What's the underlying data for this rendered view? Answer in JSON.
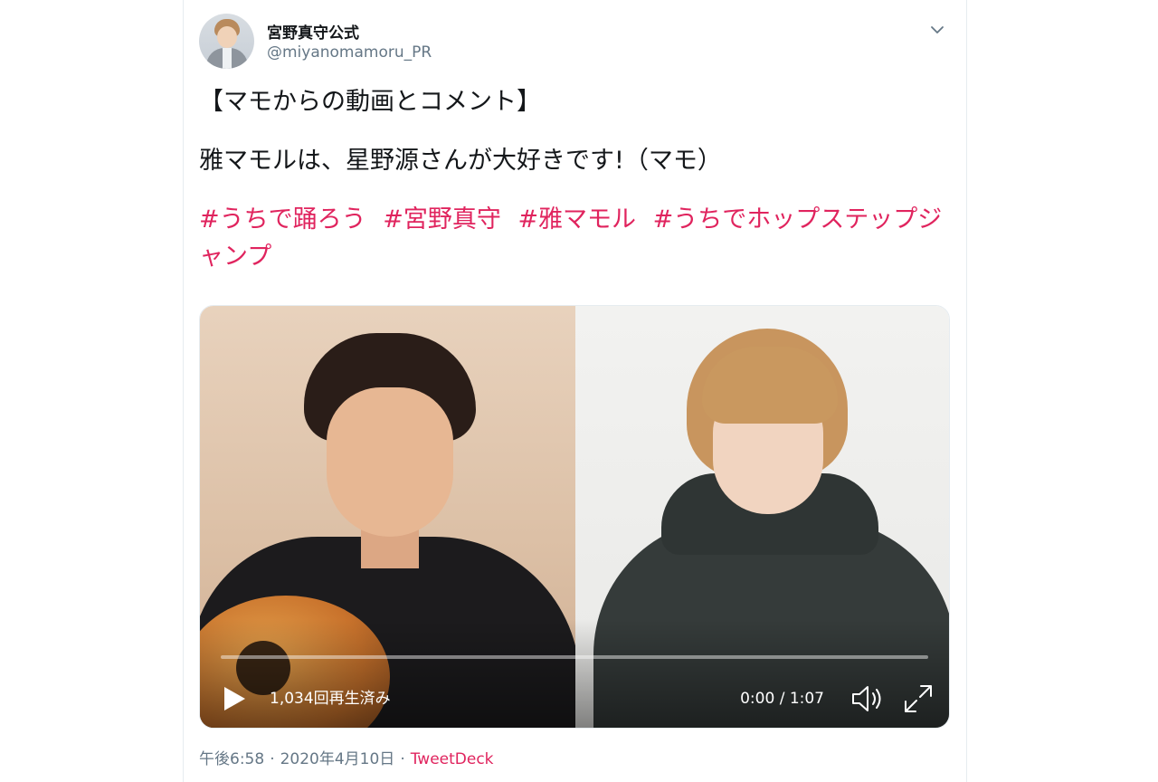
{
  "user": {
    "display_name": "宮野真守公式",
    "handle": "@miyanomamoru_PR"
  },
  "icons": {
    "avatar": "avatar",
    "menu": "chevron-down-icon",
    "play": "play-icon",
    "volume": "volume-icon",
    "fullscreen": "fullscreen-icon"
  },
  "tweet": {
    "line1": "【マモからの動画とコメント】",
    "line2": "雅マモルは、星野源さんが大好きです!（マモ）",
    "hashtags": [
      "#うちで踊ろう",
      "#宮野真守",
      "#雅マモル",
      "#うちでホップステップジャンプ"
    ]
  },
  "video": {
    "views": "1,034回再生済み",
    "time": "0:00 / 1:07",
    "progress": 0
  },
  "meta": {
    "time": "午後6:58",
    "date": "2020年4月10日",
    "separator": "·",
    "source": "TweetDeck"
  },
  "colors": {
    "hashtag": "#e0245e",
    "secondary_text": "#657786"
  }
}
